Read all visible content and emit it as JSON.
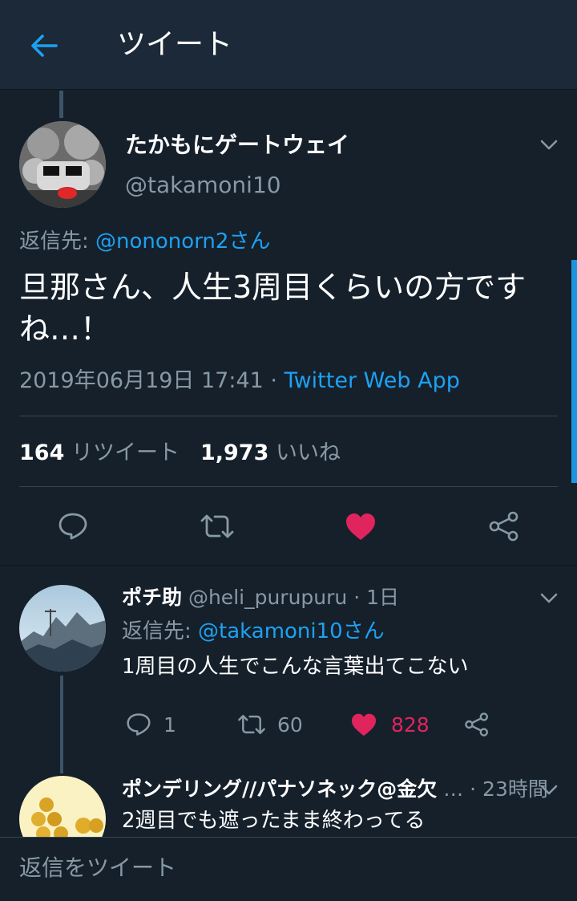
{
  "header": {
    "title": "ツイート",
    "back_icon": "arrow-left-icon"
  },
  "colors": {
    "background": "#15202b",
    "header_bg": "#1c2938",
    "accent": "#1da1f2",
    "like": "#e0245e",
    "muted": "#8899a6"
  },
  "tweet": {
    "author_name": "たかもにゲートウェイ",
    "author_handle": "@takamoni10",
    "reply_prefix": "返信先: ",
    "reply_to": "@nononorn2さん",
    "text_line1": "旦那さん、人生3周目くらいの方です",
    "text_line2": "ね…！",
    "datetime": "2019年06月19日 17:41 · ",
    "source": "Twitter Web App",
    "retweet_count": "164",
    "retweet_label": " リツイート",
    "like_count": "1,973",
    "like_label": " いいね",
    "liked": true
  },
  "replies": [
    {
      "name": "ポチ助",
      "meta": " @heli_purupuru · 1日",
      "reply_prefix": "返信先: ",
      "reply_to": "@takamoni10さん",
      "text": "1周目の人生でこんな言葉出てこない",
      "reply_count": "1",
      "retweet_count": "60",
      "like_count": "828",
      "liked": true
    },
    {
      "name": "ポンデリング//パナソネック@金欠",
      "meta": " … · 23時間",
      "text": "2週目でも遮ったまま終わってる"
    }
  ],
  "composer": {
    "placeholder": "返信をツイート"
  }
}
